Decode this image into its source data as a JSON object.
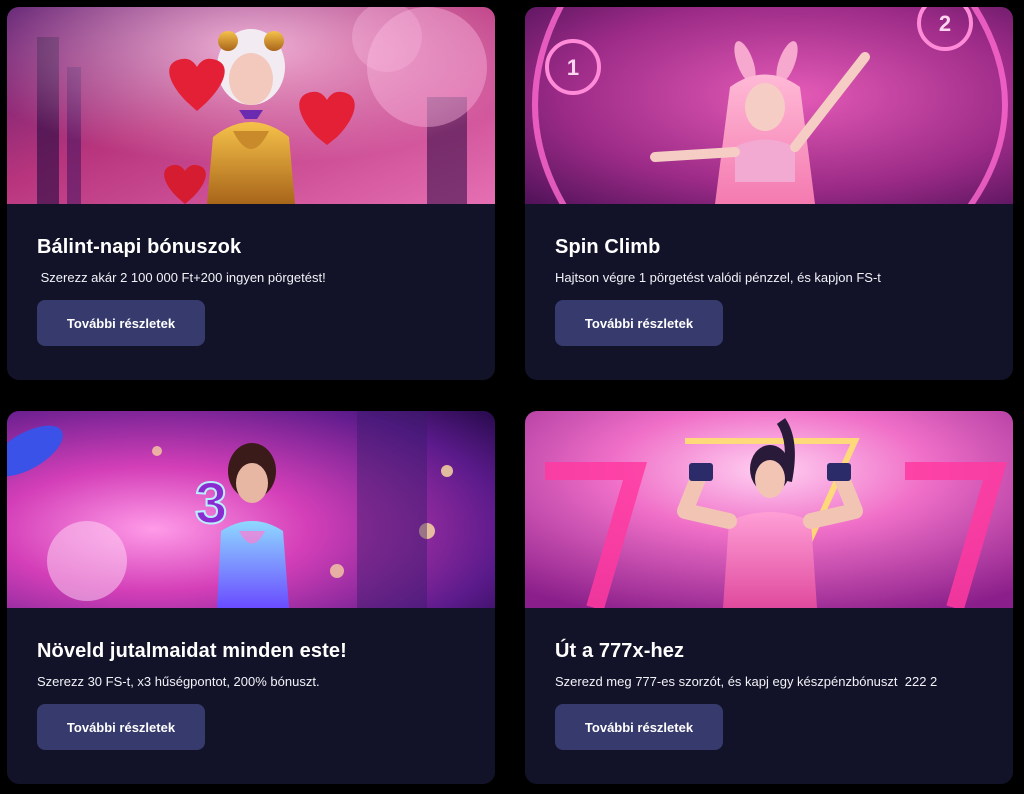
{
  "theme": {
    "page_bg": "#000000",
    "card_bg": "#121329",
    "button_bg": "#363a6d",
    "accent_pink": "#e0358f",
    "accent_purple": "#7a1fb8"
  },
  "promotions": [
    {
      "title": "Bálint-napi bónuszok",
      "description": " Szerezz akár 2 100 000 Ft+200 ingyen pörgetést!",
      "button_label": "További részletek",
      "banner_icon": "heart-icon"
    },
    {
      "title": "Spin Climb",
      "description": "Hajtson végre 1 pörgetést valódi pénzzel, és kapjon FS-t",
      "button_label": "További részletek",
      "banner_markers": [
        "1",
        "2"
      ],
      "banner_icon": "bunny-ears-icon"
    },
    {
      "title": "Növeld jutalmaidat minden este!",
      "description": "Szerezz 30 FS-t, x3 hűségpontot, 200% bónuszt.",
      "button_label": "További részletek",
      "banner_marker": "3",
      "banner_icon": "neon-number-icon"
    },
    {
      "title": "Út a 777x-hez",
      "description": "Szerezd meg 777-es szorzót, és kapj egy készpénzbónuszt  222 2",
      "button_label": "További részletek",
      "banner_icon": "neon-sevens-icon"
    }
  ]
}
